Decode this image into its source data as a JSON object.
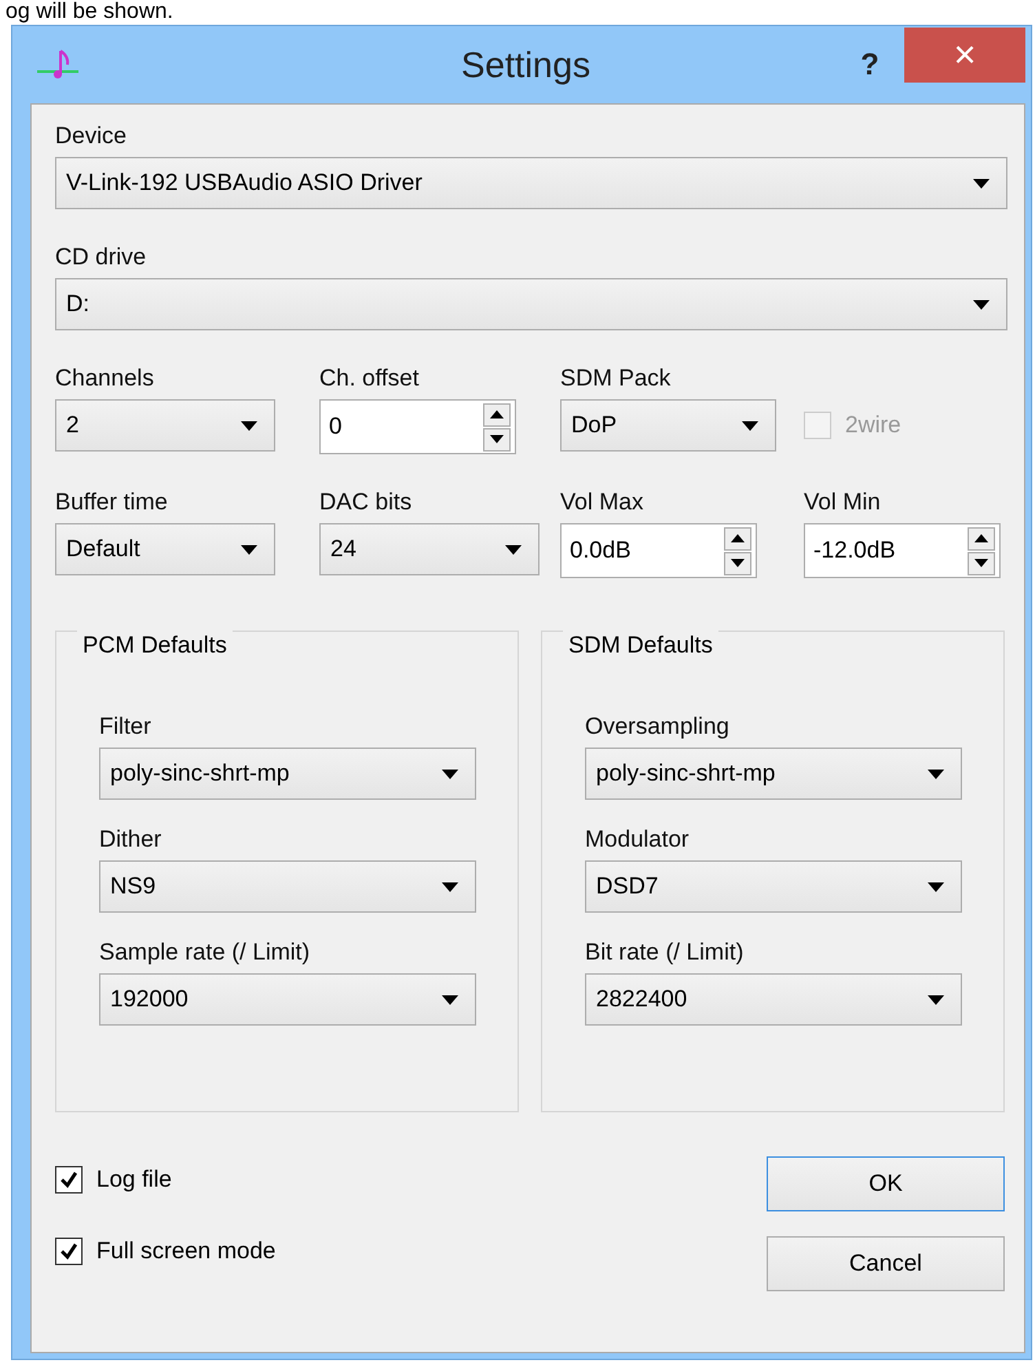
{
  "caption": "og will be shown.",
  "window": {
    "title": "Settings",
    "help": "?",
    "close": "×"
  },
  "device": {
    "label": "Device",
    "value": "V-Link-192 USBAudio ASIO Driver"
  },
  "cd_drive": {
    "label": "CD drive",
    "value": "D:"
  },
  "rows": [
    [
      {
        "kind": "combo",
        "label": "Channels",
        "value": "2"
      },
      {
        "kind": "spin",
        "label": "Ch. offset",
        "value": "0"
      },
      {
        "kind": "combo",
        "label": "SDM Pack",
        "value": "DoP"
      },
      {
        "kind": "checkbox",
        "label": "2wire",
        "checked": false,
        "disabled": true
      }
    ],
    [
      {
        "kind": "combo",
        "label": "Buffer time",
        "value": "Default"
      },
      {
        "kind": "combo",
        "label": "DAC bits",
        "value": "24"
      },
      {
        "kind": "spin",
        "label": "Vol Max",
        "value": "0.0dB"
      },
      {
        "kind": "spin",
        "label": "Vol Min",
        "value": "-12.0dB"
      }
    ]
  ],
  "groups": [
    {
      "title": "PCM Defaults",
      "fields": [
        {
          "label": "Filter",
          "value": "poly-sinc-shrt-mp"
        },
        {
          "label": "Dither",
          "value": "NS9"
        },
        {
          "label": "Sample rate (/ Limit)",
          "value": "192000"
        }
      ]
    },
    {
      "title": "SDM Defaults",
      "fields": [
        {
          "label": "Oversampling",
          "value": "poly-sinc-shrt-mp"
        },
        {
          "label": "Modulator",
          "value": "DSD7"
        },
        {
          "label": "Bit rate (/ Limit)",
          "value": "2822400"
        }
      ]
    }
  ],
  "options": [
    {
      "label": "Log file",
      "checked": true
    },
    {
      "label": "Full screen mode",
      "checked": true
    }
  ],
  "buttons": [
    {
      "label": "OK",
      "default": true
    },
    {
      "label": "Cancel",
      "default": false
    }
  ]
}
